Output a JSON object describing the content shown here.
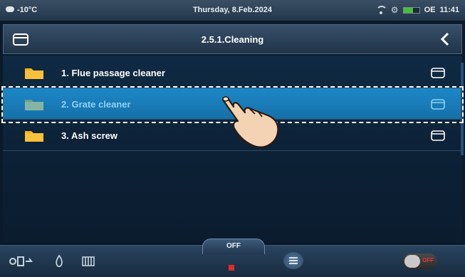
{
  "status_bar": {
    "outside_temp": "-10°C",
    "date": "Thursday, 8.Feb.2024",
    "mode": "OE",
    "time": "11:41"
  },
  "header": {
    "title": "2.5.1.Cleaning",
    "menu_icon": "folder-outline-icon",
    "back_icon": "chevron-left-icon"
  },
  "list": {
    "items": [
      {
        "label": "1. Flue passage cleaner",
        "folder_color": "#f2b01e"
      },
      {
        "label": "2. Grate cleaner",
        "folder_color": "#7fae9e"
      },
      {
        "label": "3. Ash screw",
        "folder_color": "#f2b01e"
      }
    ],
    "selected_index": 1
  },
  "bottom_bar": {
    "mode_tab": "OFF",
    "toggle_label": "OFF",
    "icons": [
      "boiler-mode-icon",
      "flame-icon",
      "heater-icon",
      "menu-icon"
    ]
  },
  "colors": {
    "accent": "#1d87c7",
    "folder": "#f2b01e",
    "alarm_red": "#e02b2b"
  }
}
